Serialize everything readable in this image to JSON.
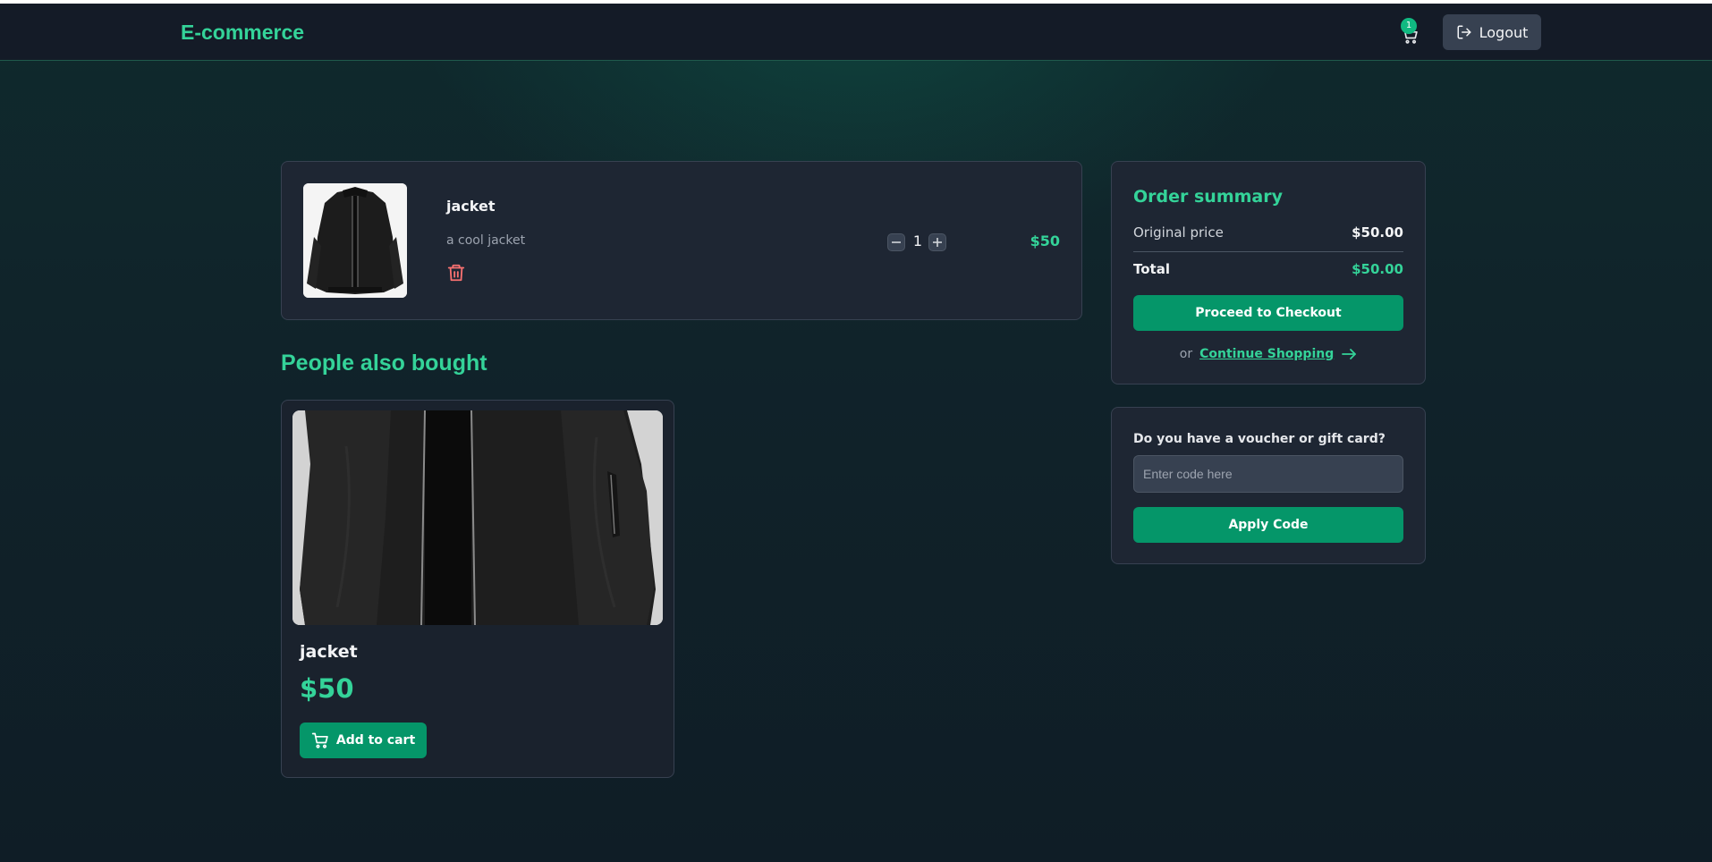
{
  "header": {
    "brand": "E-commerce",
    "cart_count": "1",
    "logout_label": "Logout"
  },
  "cart": {
    "items": [
      {
        "name": "jacket",
        "description": "a cool jacket",
        "quantity": "1",
        "price": "$50",
        "image_icon": "jacket-image"
      }
    ]
  },
  "recommendations": {
    "title": "People also bought",
    "products": [
      {
        "name": "jacket",
        "price": "$50",
        "add_label": "Add to cart",
        "image_icon": "jacket-image"
      }
    ]
  },
  "summary": {
    "title": "Order summary",
    "original_label": "Original price",
    "original_value": "$50.00",
    "total_label": "Total",
    "total_value": "$50.00",
    "checkout_label": "Proceed to Checkout",
    "or_text": "or",
    "continue_label": "Continue Shopping"
  },
  "voucher": {
    "label": "Do you have a voucher or gift card?",
    "placeholder": "Enter code here",
    "apply_label": "Apply Code"
  },
  "colors": {
    "accent": "#34d399",
    "button": "#059669",
    "danger": "#f87171",
    "card": "#1e2633"
  }
}
